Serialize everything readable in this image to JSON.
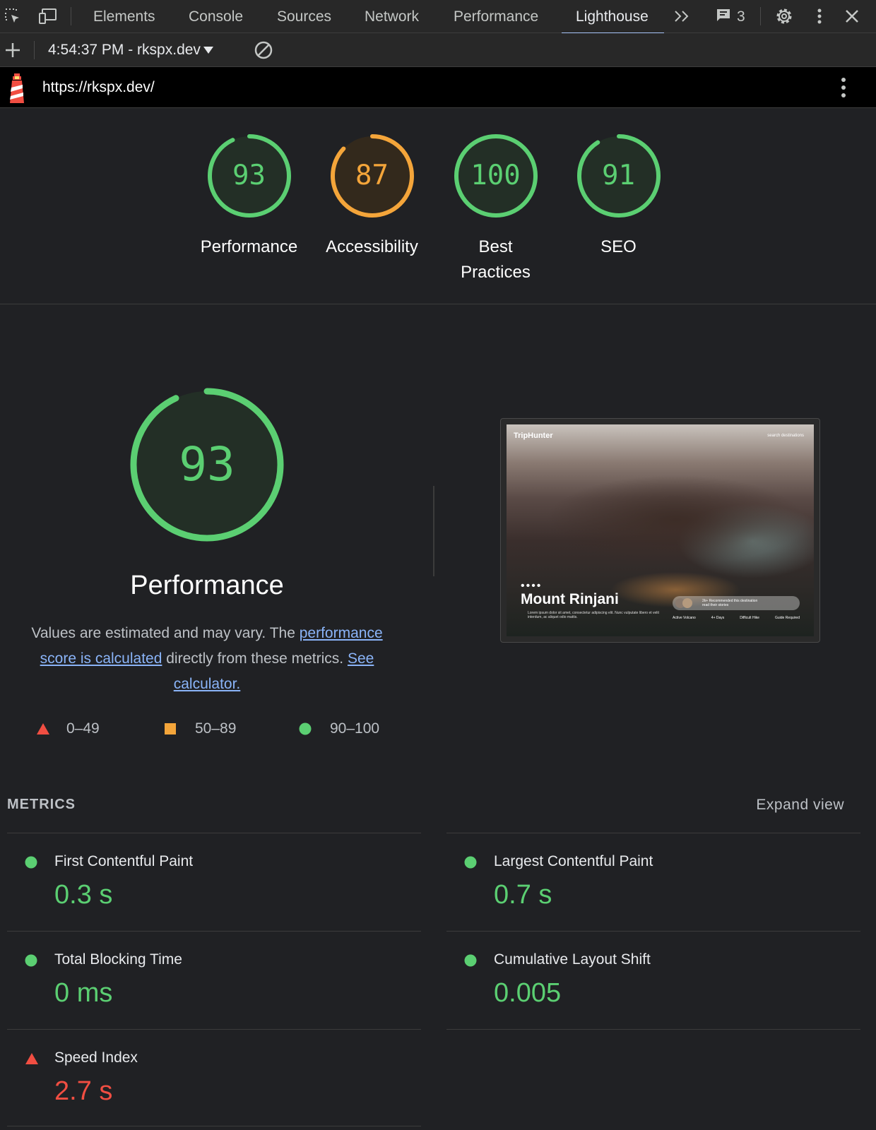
{
  "devtools": {
    "tabs": [
      "Elements",
      "Console",
      "Sources",
      "Network",
      "Performance",
      "Lighthouse"
    ],
    "active_tab": "Lighthouse",
    "message_count": "3",
    "report": "4:54:37 PM - rkspx.dev"
  },
  "url": "https://rkspx.dev/",
  "categories": [
    {
      "label": "Performance",
      "score": "93",
      "rating": "pass",
      "fraction": 0.93
    },
    {
      "label": "Accessibility",
      "score": "87",
      "rating": "average",
      "fraction": 0.87
    },
    {
      "label": "Best Practices",
      "score": "100",
      "rating": "pass",
      "fraction": 1.0
    },
    {
      "label": "SEO",
      "score": "91",
      "rating": "pass",
      "fraction": 0.91
    }
  ],
  "performance": {
    "title": "Performance",
    "score": "93",
    "fraction": 0.93,
    "desc_1": "Values are estimated and may vary. The ",
    "link_1": "performance score is calculated",
    "desc_2": " directly from these metrics. ",
    "link_2": "See calculator."
  },
  "legend": [
    {
      "range": "0–49",
      "shape": "triangle",
      "color": "#f14e42"
    },
    {
      "range": "50–89",
      "shape": "square",
      "color": "#f4a53a"
    },
    {
      "range": "90–100",
      "shape": "circle",
      "color": "#5bcf72"
    }
  ],
  "thumbnail": {
    "brand": "TripHunter",
    "search": "search destinations",
    "title": "Mount Rinjani",
    "lorem": "Lorem ipsum dolor sit amet, consectetur adipiscing elit. Nunc vulputate libero et velit interdum, ac aliquet odio mattis.",
    "pill_line1": "2k+ Recommended this destination",
    "pill_line2": "read their stories",
    "tags": [
      "Active Volcano",
      "4+ Days",
      "Difficult Hike",
      "Guide Required"
    ]
  },
  "metrics": {
    "title": "METRICS",
    "expand_label": "Expand view",
    "items": [
      {
        "label": "First Contentful Paint",
        "value": "0.3 s",
        "rating": "pass"
      },
      {
        "label": "Largest Contentful Paint",
        "value": "0.7 s",
        "rating": "pass"
      },
      {
        "label": "Total Blocking Time",
        "value": "0 ms",
        "rating": "pass"
      },
      {
        "label": "Cumulative Layout Shift",
        "value": "0.005",
        "rating": "pass"
      },
      {
        "label": "Speed Index",
        "value": "2.7 s",
        "rating": "fail"
      }
    ]
  },
  "colors": {
    "pass": "#5bcf72",
    "average": "#f4a53a",
    "fail": "#f14e42",
    "link": "#8ab4f8",
    "background": "#202124"
  }
}
